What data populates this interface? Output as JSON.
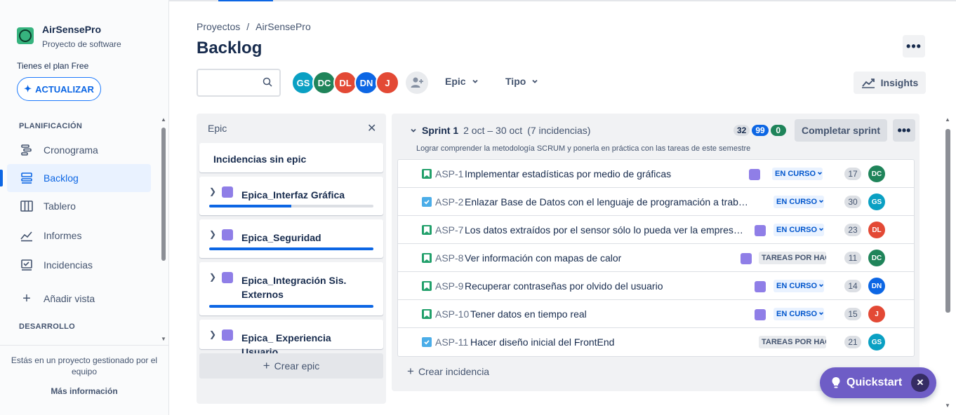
{
  "sidebar": {
    "project_name": "AirSensePro",
    "project_type": "Proyecto de software",
    "plan_text": "Tienes el plan Free",
    "upgrade_label": "ACTUALIZAR",
    "planning_header": "PLANIFICACIÓN",
    "items": [
      {
        "label": "Cronograma",
        "icon": "timeline-icon"
      },
      {
        "label": "Backlog",
        "icon": "backlog-icon",
        "active": true
      },
      {
        "label": "Tablero",
        "icon": "board-icon"
      },
      {
        "label": "Informes",
        "icon": "reports-icon"
      },
      {
        "label": "Incidencias",
        "icon": "issues-icon"
      },
      {
        "label": "Añadir vista",
        "icon": "plus-icon"
      }
    ],
    "dev_header": "DESARROLLO",
    "footer_text": "Estás en un proyecto gestionado por el equipo",
    "footer_link": "Más información"
  },
  "header": {
    "breadcrumbs": [
      "Proyectos",
      "AirSensePro"
    ],
    "breadcrumb_sep": "/",
    "title": "Backlog"
  },
  "toolbar": {
    "search_placeholder": "",
    "avatars": [
      {
        "initials": "GS",
        "color": "#0aa0c3"
      },
      {
        "initials": "DC",
        "color": "#1f845a"
      },
      {
        "initials": "DL",
        "color": "#e34935"
      },
      {
        "initials": "DN",
        "color": "#0c66e4"
      },
      {
        "initials": "J",
        "color": "#e34935"
      }
    ],
    "epic_filter": "Epic",
    "type_filter": "Tipo",
    "insights_label": "Insights"
  },
  "epic_panel": {
    "title": "Epic",
    "no_epic": "Incidencias sin epic",
    "epics": [
      {
        "name": "Epica_Interfaz Gráfica",
        "progress": 0.5
      },
      {
        "name": "Epica_Seguridad",
        "progress": 1.0
      },
      {
        "name": "Epica_Integración Sis. Externos",
        "progress": 1.0
      },
      {
        "name": "Epica_ Experiencia Usuario",
        "progress": null
      }
    ],
    "create_epic": "Crear epic"
  },
  "sprint": {
    "name": "Sprint 1",
    "dates": "2 oct – 30 oct",
    "issue_count": "(7 incidencias)",
    "goal": "Lograr comprender la metodología SCRUM y ponerla en práctica con las tareas de este semestre",
    "counts": {
      "todo": "32",
      "in_progress": "99",
      "done": "0"
    },
    "complete_label": "Completar sprint",
    "create_issue": "Crear incidencia",
    "issues": [
      {
        "key": "ASP-1",
        "title": "Implementar estadísticas por medio de gráficas",
        "type": "story",
        "status": "EN CURSO",
        "status_kind": "prog",
        "points": "17",
        "assignee": "DC",
        "assignee_color": "#1f845a",
        "has_epic": true
      },
      {
        "key": "ASP-2",
        "title": "Enlazar Base de Datos con el lenguaje de programación a trabaj...",
        "type": "task",
        "status": "EN CURSO",
        "status_kind": "prog",
        "points": "30",
        "assignee": "GS",
        "assignee_color": "#0aa0c3",
        "has_epic": false
      },
      {
        "key": "ASP-7",
        "title": "Los datos extraídos por el sensor sólo lo pueda ver la empresa q...",
        "type": "story",
        "status": "EN CURSO",
        "status_kind": "prog",
        "points": "23",
        "assignee": "DL",
        "assignee_color": "#e34935",
        "has_epic": true
      },
      {
        "key": "ASP-8",
        "title": "Ver información con mapas de calor",
        "type": "story",
        "status": "TAREAS POR HAC",
        "status_kind": "todo",
        "points": "11",
        "assignee": "DC",
        "assignee_color": "#1f845a",
        "has_epic": true
      },
      {
        "key": "ASP-9",
        "title": "Recuperar contraseñas por olvido del usuario",
        "type": "story",
        "status": "EN CURSO",
        "status_kind": "prog",
        "points": "14",
        "assignee": "DN",
        "assignee_color": "#0c66e4",
        "has_epic": true
      },
      {
        "key": "ASP-10",
        "title": "Tener datos en tiempo real",
        "type": "story",
        "status": "EN CURSO",
        "status_kind": "prog",
        "points": "15",
        "assignee": "J",
        "assignee_color": "#e34935",
        "has_epic": true
      },
      {
        "key": "ASP-11",
        "title": "Hacer diseño inicial del FrontEnd",
        "type": "task",
        "status": "TAREAS POR HAC",
        "status_kind": "todo",
        "points": "21",
        "assignee": "GS",
        "assignee_color": "#0aa0c3",
        "has_epic": false
      }
    ]
  },
  "quickstart": {
    "label": "Quickstart"
  }
}
